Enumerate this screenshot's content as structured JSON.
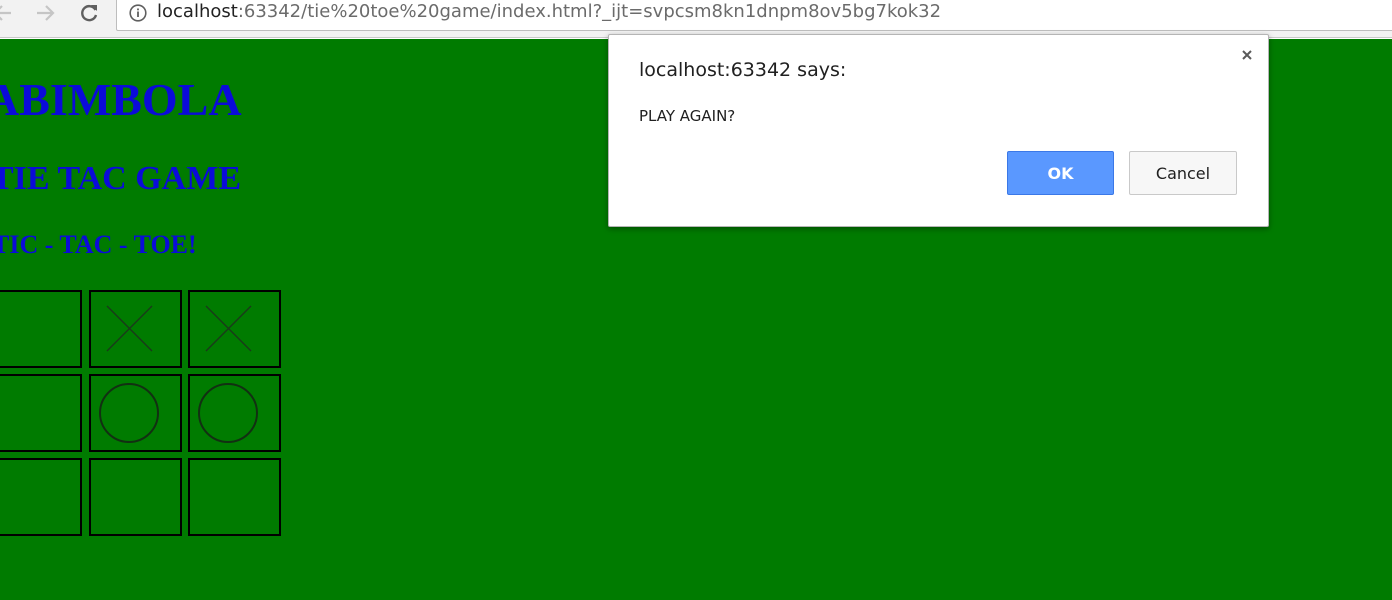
{
  "browser": {
    "url_host": "localhost",
    "url_rest": ":63342/tie%20toe%20game/index.html?_ijt=svpcsm8kn1dnpm8ov5bg7kok32",
    "icons": {
      "back": "arrow-left-icon",
      "forward": "arrow-right-icon",
      "reload": "reload-icon",
      "info": "info-circle-icon"
    }
  },
  "page": {
    "background": "#007b00",
    "heading_color": "#0b0bd9",
    "headings": [
      "ABIMBOLA",
      "TIE TAC GAME",
      "TIC - TAC - TOE!"
    ]
  },
  "board": {
    "cells": [
      "",
      "X",
      "X",
      "",
      "O",
      "O",
      "",
      "",
      ""
    ]
  },
  "dialog": {
    "title": "localhost:63342 says:",
    "message": "PLAY AGAIN?",
    "ok_label": "OK",
    "cancel_label": "Cancel",
    "ok_color": "#5a98ff",
    "close_icon": "close-icon"
  }
}
